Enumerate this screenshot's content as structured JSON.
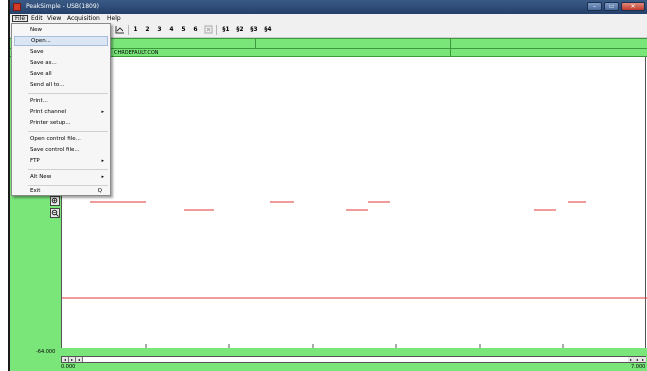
{
  "window": {
    "title": "PeakSimple - USB(1809)",
    "buttons": {
      "minimize": "–",
      "maximize": "▭",
      "close": "✕"
    }
  },
  "menubar": {
    "items": [
      "File",
      "Edit",
      "View",
      "Acquisition",
      "Help"
    ]
  },
  "toolbar": {
    "channels": [
      "1",
      "2",
      "3",
      "4",
      "5",
      "6"
    ],
    "tool_icons": [
      "integration-icon",
      "zoom-icon"
    ],
    "channel_groups": [
      "§1",
      "§2",
      "§3",
      "§4"
    ]
  },
  "status": {
    "control_file": "CHRDEFAULT.CON"
  },
  "chart": {
    "y_min": "-64.000",
    "x_min": "0.000",
    "x_max": "7.000"
  },
  "file_menu": {
    "items": [
      {
        "label": "New"
      },
      {
        "label": "Open..."
      },
      {
        "label": "Save"
      },
      {
        "label": "Save as..."
      },
      {
        "label": "Save all"
      },
      {
        "label": "Send all to..."
      },
      {
        "label": "Print..."
      },
      {
        "label": "Print channel",
        "submenu": true
      },
      {
        "label": "Printer setup..."
      },
      {
        "label": "Open control file..."
      },
      {
        "label": "Save control file..."
      },
      {
        "label": "FTP",
        "submenu": true
      },
      {
        "label": "Alt New",
        "submenu": true
      },
      {
        "label": "Exit",
        "shortcut": "Q"
      }
    ]
  },
  "colors": {
    "status_green": "#7ae67a",
    "trace_red": "#e03a3a",
    "titlebar": "#2c4a78"
  }
}
